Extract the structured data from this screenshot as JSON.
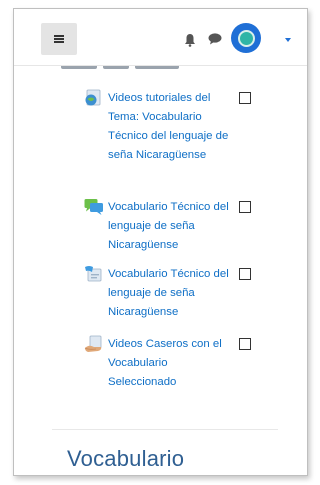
{
  "navbar": {
    "menu_icon": "hamburger-icon",
    "notification_icon": "bell-icon",
    "messages_icon": "chat-bubble-icon",
    "user_menu_icon": "caret-down-icon",
    "accent_color": "#1f6fd6"
  },
  "activities": [
    {
      "icon": "video-file-icon",
      "label": "Videos tutoriales del Tema: Vocabulario Técnico del lenguaje de seña Nicaragüense",
      "checked": false
    },
    {
      "icon": "forum-icon",
      "label": "Vocabulario Técnico del lenguaje de seña Nicaragüense",
      "checked": false
    },
    {
      "icon": "chat-activity-icon",
      "label": "Vocabulario Técnico del lenguaje de seña Nicaragüense",
      "checked": false
    },
    {
      "icon": "assignment-icon",
      "label": "Videos Caseros con el Vocabulario Seleccionado",
      "checked": false
    }
  ],
  "next_section": {
    "title": "Vocabulario"
  },
  "colors": {
    "link": "#0f6fc6",
    "section_title": "#2f5f92"
  }
}
